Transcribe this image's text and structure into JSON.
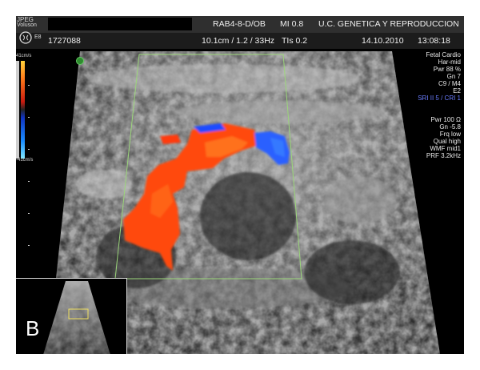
{
  "header": {
    "logo_small": "JPEG",
    "logo_brand": "Voluson",
    "logo_e8": "E8",
    "patient_id": "1727088",
    "probe": "RAB4-8-D/OB",
    "mi": "MI  0.8",
    "institution": "U.C. GENETICA Y REPRODUCCION",
    "depth": "10.1cm / 1.2 / 33Hz",
    "tis": "TIs  0.2",
    "date": "14.10.2010",
    "time": "13:08:18"
  },
  "colorbar": {
    "top_label": "41cm/s",
    "bottom_label": "-41cm/s"
  },
  "params": {
    "preset": "Fetal Cardio",
    "har": "Har-mid",
    "pwr": "Pwr  88 %",
    "gn": "Gn  7",
    "c9m4": "C9 / M4",
    "e2": "E2",
    "sri": "SRI II 5 / CRI 1",
    "pwr2": "Pwr 100",
    "pwr2_icon": "Ω",
    "gn2": "Gn -5.8",
    "frq": "Frq low",
    "qual": "Qual high",
    "wmf": "WMF mid1",
    "prf": "PRF  3.2kHz"
  },
  "thumbnail": {
    "label": "B"
  },
  "colors": {
    "doppler_red": "#ff4a10",
    "doppler_blue": "#1e4cff",
    "roi_box": "#9bd67a",
    "sri_text": "#6a7dff"
  }
}
